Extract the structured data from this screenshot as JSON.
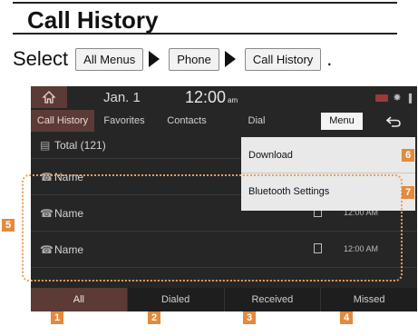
{
  "header": {
    "title": "Call History"
  },
  "instruction": {
    "select_word": "Select",
    "steps": [
      "All Menus",
      "Phone",
      "Call History"
    ],
    "end": "."
  },
  "status": {
    "date": "Jan.  1",
    "time": "12:00",
    "ampm": "am"
  },
  "tabs": [
    "Call History",
    "Favorites",
    "Contacts",
    "Dial"
  ],
  "menu_label": "Menu",
  "total_label": "Total (121)",
  "calls": [
    {
      "name": "Name",
      "time": ""
    },
    {
      "name": "Name",
      "time": "12:00 AM"
    },
    {
      "name": "Name",
      "time": "12:00 AM"
    }
  ],
  "dropdown": [
    "Download",
    "Bluetooth Settings"
  ],
  "bottom_tabs": [
    "All",
    "Dialed",
    "Received",
    "Missed"
  ],
  "callouts": [
    "1",
    "2",
    "3",
    "4",
    "5",
    "6",
    "7"
  ],
  "colors": {
    "accent": "#5c3a36",
    "callout": "#e38a3d",
    "dotted": "#e9a062"
  }
}
